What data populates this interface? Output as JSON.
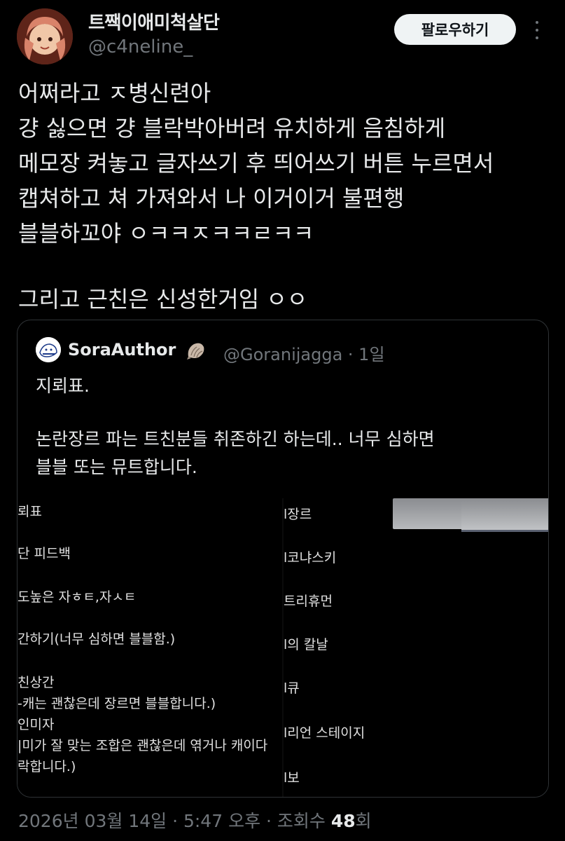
{
  "author": {
    "display_name": "트짹이애미척살단",
    "handle": "@c4neline_"
  },
  "follow_button": "팔로우하기",
  "tweet": {
    "lines": [
      "어쩌라고 ㅈ병신련아",
      "걍 싫으면 걍 블락박아버려 유치하게 음침하게",
      "메모장 켜놓고 글자쓰기 후 띄어쓰기 버튼 누르면서",
      "캡쳐하고 쳐 가져와서 나 이거이거 불편행",
      "블블하꼬야 ㅇㅋㅋㅈㅋㅋㄹㅋㅋ",
      "그리고 근친은 신성한거임 ㅇㅇ"
    ]
  },
  "quote": {
    "name": "SoraAuthor",
    "handle_and_time": "@Goranijagga · 1일",
    "lines": [
      "지뢰표.",
      "논란장르 파는 트친분들 취존하긴 하는데.. 너무 심하면",
      "블블 또는 뮤트합니다."
    ],
    "image_left_lines": [
      "뢰표",
      "단 피드백",
      "도높은 자ㅎㅌ,자ㅅㅌ",
      "간하기(너무 심하면 블블함.)",
      "친상간",
      "-캐는 괜찮은데 장르면 블블합니다.)",
      "인미자",
      "|미가 잘 맞는 조합은 괜찮은데 엮거나 캐이다",
      "락합니다.)"
    ],
    "image_right_lines": [
      "l장르",
      "l코냐스키",
      "트리휴먼",
      "l의 칼날",
      "l큐",
      "l리언 스테이지",
      "l보"
    ]
  },
  "meta": {
    "date": "2026년 03월 14일 · 5:47 오후 · 조회수 ",
    "views": "48",
    "views_suffix": "회"
  },
  "colors": {
    "background": "#000000",
    "text": "#e7e9ea",
    "secondary": "#71767b",
    "follow_bg": "#eff3f4"
  }
}
